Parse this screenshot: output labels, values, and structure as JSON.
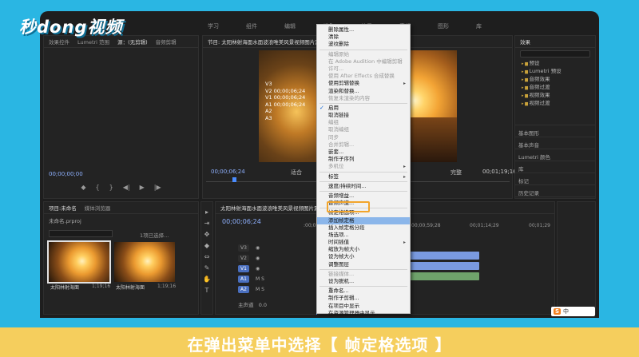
{
  "brand": {
    "logo_text": "秒dong视频"
  },
  "top_menu": [
    "学习",
    "组件",
    "编辑",
    "颜色",
    "效果",
    "音频",
    "图形",
    "库"
  ],
  "source_panel": {
    "tabs": [
      "效果控件",
      "Lumetri 范围",
      "源：(无剪辑)",
      "音频剪辑"
    ],
    "timecode": "00;00;00;00"
  },
  "program_panel": {
    "title": "节目: 太阳林射海面水面波浪唯美风景视频图片素材",
    "overlay_lines": [
      "V3",
      "V2 00;00;06;24",
      "V1 00;00;06;24",
      "A1 00;00;06;24",
      "A2",
      "A3"
    ],
    "timecode": "00;00;06;24",
    "fit": "适合",
    "quality": "完整",
    "duration": "00;01;19;16"
  },
  "effects_panel": {
    "title": "效果",
    "items": [
      "预设",
      "Lumetri 预设",
      "音频效果",
      "音频过渡",
      "视频效果",
      "视频过渡"
    ],
    "sections": [
      "基本图形",
      "基本声音",
      "Lumetri 颜色",
      "库",
      "标记",
      "历史记录",
      "信息"
    ]
  },
  "project_panel": {
    "tabs": [
      "项目:未命名",
      "媒体浏览器"
    ],
    "project_name": "未命名.prproj",
    "count": "1项已选择...",
    "items": [
      {
        "label": "太阳林射海面",
        "duration": "1;19;16"
      },
      {
        "label": "太阳林射海面",
        "duration": "1;19;16"
      }
    ]
  },
  "timeline": {
    "tab": "太阳林射海面水面波浪唯美风景视频图片素材",
    "timecode": "00;00;06;24",
    "ruler_labels": [
      ":00;00",
      "00;00;59;28",
      "00;01;14;29",
      "00;01;29"
    ],
    "tracks": [
      "V3",
      "V2",
      "V1",
      "A1",
      "A2",
      "A3"
    ],
    "master": "主声道",
    "master_value": "0.0",
    "clip_label": "fx 太阳"
  },
  "context_menu": {
    "items": [
      {
        "label": "删除属性...",
        "state": "enabled"
      },
      {
        "label": "清除",
        "state": "enabled"
      },
      {
        "label": "波纹删除",
        "state": "enabled"
      },
      {
        "sep": true
      },
      {
        "label": "编辑原始",
        "state": "disabled"
      },
      {
        "label": "在 Adobe Audition 中编辑剪辑",
        "state": "disabled"
      },
      {
        "label": "许可...",
        "state": "disabled"
      },
      {
        "label": "使用 After Effects 合成替换",
        "state": "disabled"
      },
      {
        "label": "使用剪辑替换",
        "state": "enabled",
        "sub": true
      },
      {
        "label": "渲染和替换...",
        "state": "enabled"
      },
      {
        "label": "恢复未渲染的内容",
        "state": "disabled"
      },
      {
        "sep": true
      },
      {
        "label": "启用",
        "state": "enabled",
        "checked": true
      },
      {
        "label": "取消链接",
        "state": "enabled"
      },
      {
        "label": "编组",
        "state": "disabled"
      },
      {
        "label": "取消编组",
        "state": "disabled"
      },
      {
        "label": "同步",
        "state": "disabled"
      },
      {
        "label": "合并剪辑...",
        "state": "disabled"
      },
      {
        "label": "嵌套...",
        "state": "enabled"
      },
      {
        "label": "制作子序列",
        "state": "enabled"
      },
      {
        "label": "多机位",
        "state": "disabled",
        "sub": true
      },
      {
        "sep": true
      },
      {
        "label": "标签",
        "state": "enabled",
        "sub": true
      },
      {
        "sep": true
      },
      {
        "label": "速度/持续时间...",
        "state": "enabled"
      },
      {
        "sep": true
      },
      {
        "label": "音频增益...",
        "state": "enabled"
      },
      {
        "label": "音频声道...",
        "state": "enabled"
      },
      {
        "sep": true
      },
      {
        "label": "帧定格选项...",
        "state": "enabled"
      },
      {
        "label": "添加帧定格",
        "state": "enabled",
        "highlight": true
      },
      {
        "label": "插入帧定格分段",
        "state": "enabled"
      },
      {
        "label": "场选项...",
        "state": "enabled"
      },
      {
        "label": "时间插值",
        "state": "enabled",
        "sub": true
      },
      {
        "label": "缩放为帧大小",
        "state": "enabled"
      },
      {
        "label": "设为帧大小",
        "state": "enabled"
      },
      {
        "label": "调整图层",
        "state": "enabled"
      },
      {
        "sep": true
      },
      {
        "label": "链接媒体...",
        "state": "disabled"
      },
      {
        "label": "设为脱机...",
        "state": "enabled"
      },
      {
        "sep": true
      },
      {
        "label": "重命名...",
        "state": "enabled"
      },
      {
        "label": "制作子剪辑...",
        "state": "enabled"
      },
      {
        "label": "在项目中显示",
        "state": "enabled"
      },
      {
        "label": "在资源管理器中显示...",
        "state": "enabled"
      }
    ]
  },
  "ime": {
    "badge": "S",
    "mode": "中"
  },
  "caption": {
    "text": "在弹出菜单中选择【 帧定格选项 】"
  },
  "colors": {
    "background": "#2ab6e3",
    "caption_bar": "#f5ce5d",
    "highlight_box": "#f2a52c",
    "menu_highlight": "#8bb6ea"
  }
}
